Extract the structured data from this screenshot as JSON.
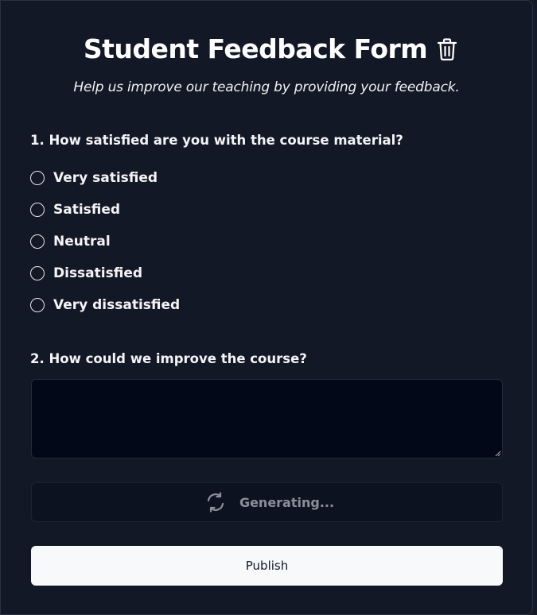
{
  "form": {
    "title": "Student Feedback Form",
    "subtitle": "Help us improve our teaching by providing your feedback.",
    "trash_icon": "trash-icon"
  },
  "question1": {
    "label": "1. How satisfied are you with the course material?",
    "options": [
      "Very satisfied",
      "Satisfied",
      "Neutral",
      "Dissatisfied",
      "Very dissatisfied"
    ]
  },
  "question2": {
    "label": "2. How could we improve the course?",
    "value": ""
  },
  "generate": {
    "label": "Generating...",
    "icon": "refresh-icon"
  },
  "publish": {
    "label": "Publish"
  },
  "colors": {
    "background": "#131826",
    "textarea_bg": "#020817",
    "publish_bg": "#f8f9fb",
    "muted_text": "#8a8f99"
  }
}
